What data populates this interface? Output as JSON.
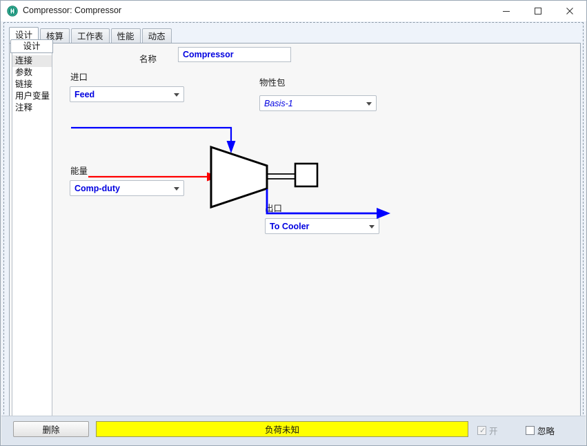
{
  "window": {
    "title": "Compressor: Compressor",
    "app_icon": "hysys-icon",
    "controls": {
      "minimize": "minimize-icon",
      "maximize": "maximize-icon",
      "close": "close-icon"
    }
  },
  "tabs": [
    {
      "label": "设计",
      "active": true
    },
    {
      "label": "核算",
      "active": false
    },
    {
      "label": "工作表",
      "active": false
    },
    {
      "label": "性能",
      "active": false
    },
    {
      "label": "动态",
      "active": false
    }
  ],
  "nav": {
    "header": "设计",
    "items": [
      {
        "label": "连接",
        "selected": true
      },
      {
        "label": "参数",
        "selected": false
      },
      {
        "label": "链接",
        "selected": false
      },
      {
        "label": "用户变量",
        "selected": false
      },
      {
        "label": "注释",
        "selected": false
      }
    ]
  },
  "form": {
    "name_label": "名称",
    "name_value": "Compressor",
    "inlet_label": "进口",
    "inlet_value": "Feed",
    "energy_label": "能量",
    "energy_value": "Comp-duty",
    "outlet_label": "出口",
    "outlet_value": "To Cooler",
    "property_package_label": "物性包",
    "property_package_value": "Basis-1"
  },
  "diagram": {
    "inlet_stream_color": "#0000ff",
    "energy_stream_color": "#ff0000",
    "outlet_stream_color": "#0000ff",
    "equipment_color": "#000000",
    "equipment": "compressor-symbol"
  },
  "bottom": {
    "delete_label": "删除",
    "status_text": "负荷未知",
    "status_color": "#ffff00",
    "on_label": "开",
    "on_checked": true,
    "ignore_label": "忽略",
    "ignore_checked": false
  }
}
